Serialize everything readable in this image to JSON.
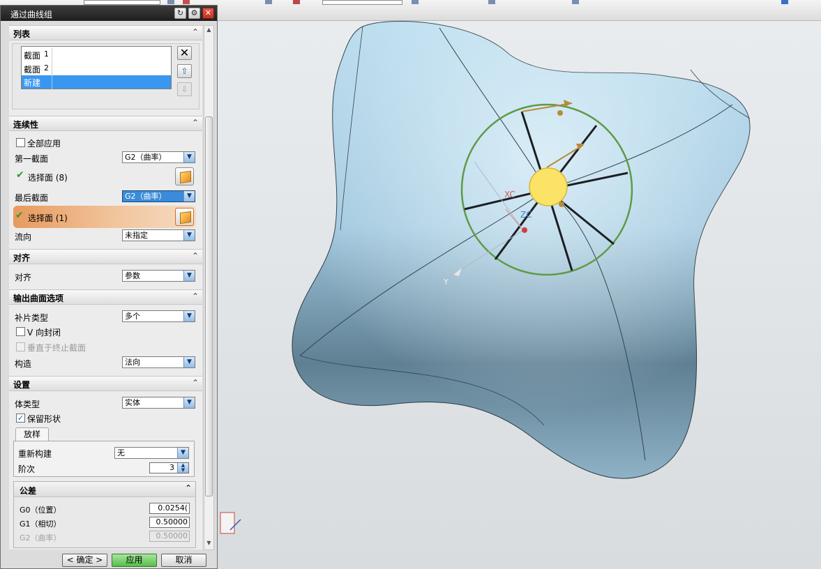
{
  "dialog": {
    "title": "通过曲线组",
    "list_section": {
      "header": "列表",
      "items": [
        {
          "name": "截面",
          "num": "1"
        },
        {
          "name": "截面",
          "num": "2"
        },
        {
          "name": "新建",
          "num": ""
        }
      ]
    },
    "continuity": {
      "header": "连续性",
      "apply_all": "全部应用",
      "first_section_label": "第一截面",
      "first_section_value": "G2（曲率）",
      "first_select": "选择面 (8)",
      "last_section_label": "最后截面",
      "last_section_value": "G2（曲率）",
      "last_select": "选择面 (1)",
      "flow_label": "流向",
      "flow_value": "未指定"
    },
    "alignment": {
      "header": "对齐",
      "label": "对齐",
      "value": "参数"
    },
    "output": {
      "header": "输出曲面选项",
      "patch_label": "补片类型",
      "patch_value": "多个",
      "v_closed": "V 向封闭",
      "normal_to_end": "垂直于终止截面",
      "construct_label": "构造",
      "construct_value": "法向"
    },
    "settings": {
      "header": "设置",
      "body_type_label": "体类型",
      "body_type_value": "实体",
      "keep_shape": "保留形状",
      "tab": "放样",
      "rebuild_label": "重新构建",
      "rebuild_value": "无",
      "degree_label": "阶次",
      "degree_value": "3"
    },
    "tolerance": {
      "header": "公差",
      "g0_label": "G0（位置）",
      "g0_value": "0.0254(",
      "g1_label": "G1（相切）",
      "g1_value": "0.50000",
      "g2_label": "G2（曲率）",
      "g2_value": "0.50000"
    },
    "buttons": {
      "ok": "< 确定 >",
      "apply": "应用",
      "cancel": "取消"
    }
  },
  "viewport": {
    "axis_x": "XC",
    "axis_z": "ZC",
    "axis_y": "Y",
    "model_color": "#a9cfe6"
  }
}
